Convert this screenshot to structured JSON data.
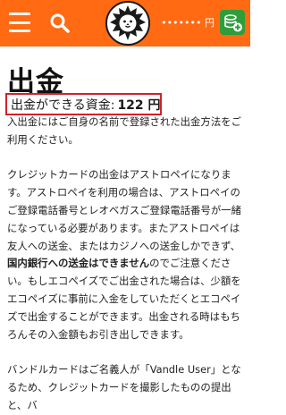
{
  "header": {
    "balance_text": "••••••• 円",
    "colors": {
      "header_bg": "#ff6a13",
      "deposit_bg": "#2e9e3a"
    },
    "icons": [
      "menu-icon",
      "search-icon",
      "lion-logo",
      "deposit-plus-icon"
    ]
  },
  "page": {
    "title": "出金",
    "amount_label": "出金ができる資金:",
    "amount_value": "122 円"
  },
  "paragraphs": {
    "p1": "入出金にはご自身の名前で登録された出金方法をご利用ください。",
    "p2a": "クレジットカードの出金はアストロペイになります。アストロペイを利用の場合は、アストロペイのご登録電話番号とレオベガスご登録電話番号が一緒になっている必要があります。またアストロペイは友人への送金、またはカジノへの送金しかできず、",
    "p2b": "国内銀行への送金はできません",
    "p2c": "のでご注意ください。もしエコペイズでご出金された場合は、少額をエコペイズに事前に入金をしていただくとエコペイズで出金することができます。出金される時はもちろんその入金額もお引き出しできます。",
    "p3": "バンドルカードはご名義人が「Vandle User」となるため、クレジットカードを撮影したものの提出と、バ"
  }
}
